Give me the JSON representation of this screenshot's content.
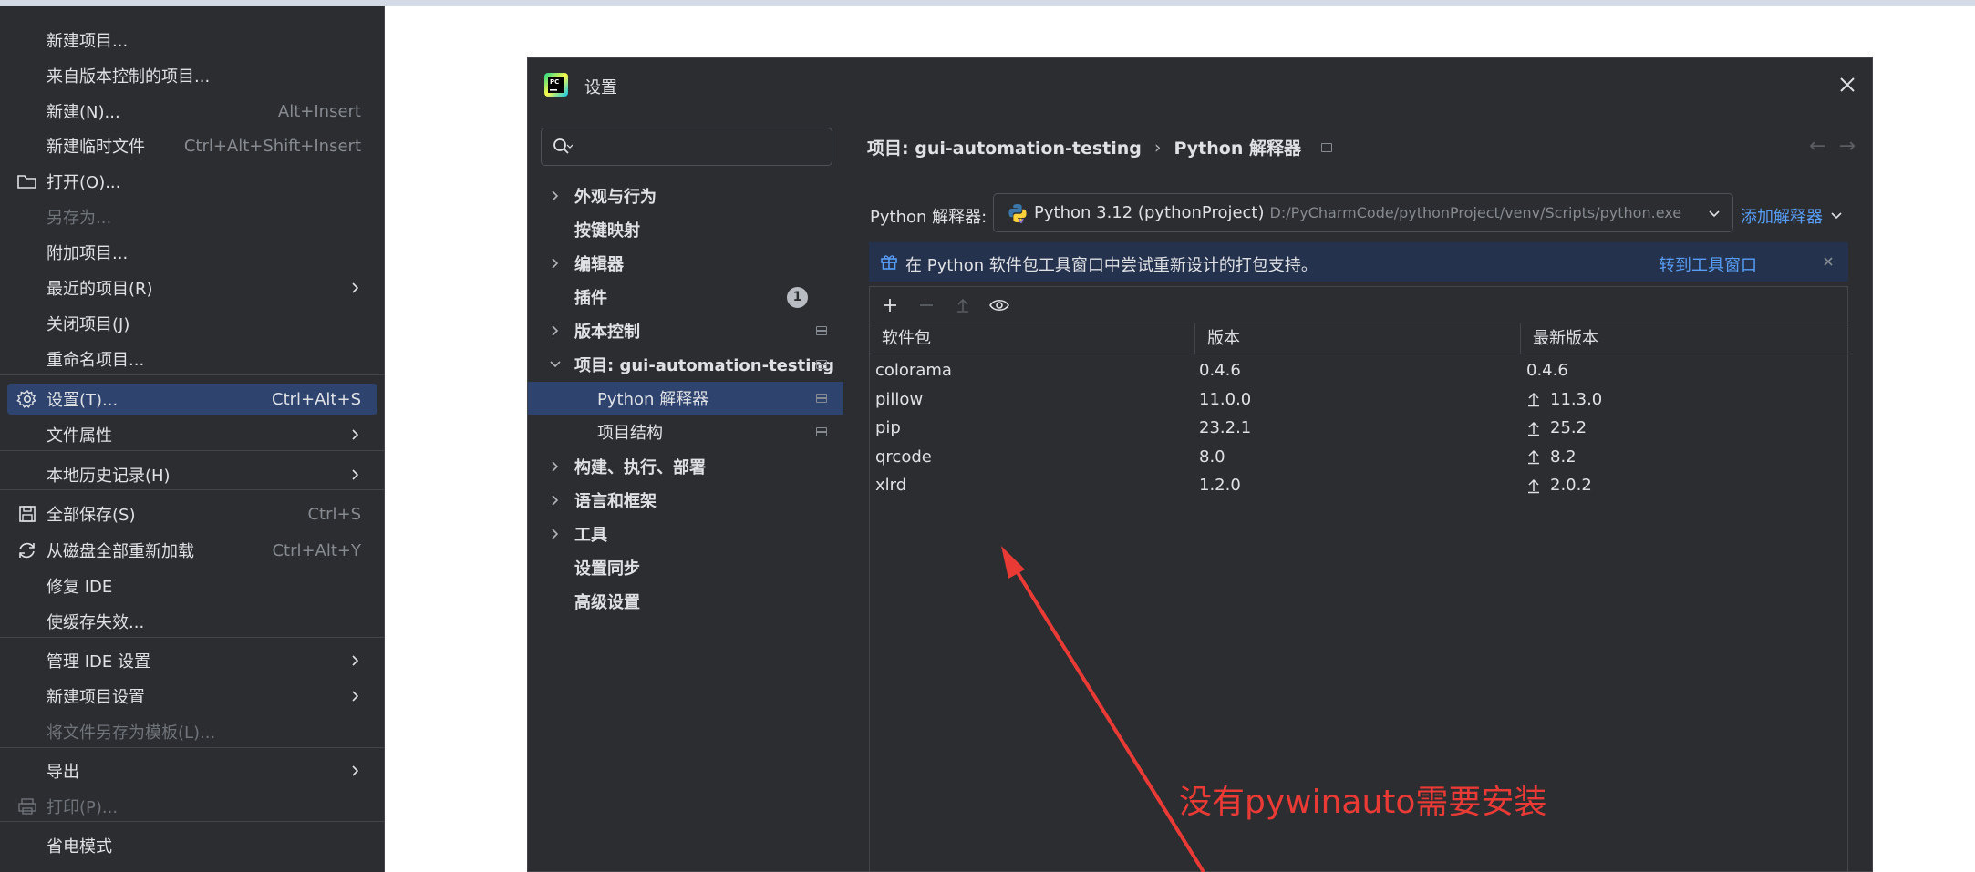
{
  "menu": {
    "items": [
      {
        "label": "新建项目...",
        "shortcut": "",
        "submenu": false,
        "icon": "",
        "disabled": false,
        "selected": false
      },
      {
        "label": "来自版本控制的项目...",
        "shortcut": "",
        "submenu": false,
        "icon": "",
        "disabled": false,
        "selected": false
      },
      {
        "label": "新建(N)...",
        "shortcut": "Alt+Insert",
        "submenu": false,
        "icon": "",
        "disabled": false,
        "selected": false
      },
      {
        "label": "新建临时文件",
        "shortcut": "Ctrl+Alt+Shift+Insert",
        "submenu": false,
        "icon": "",
        "disabled": false,
        "selected": false
      },
      {
        "label": "打开(O)...",
        "shortcut": "",
        "submenu": false,
        "icon": "folder-icon",
        "disabled": false,
        "selected": false
      },
      {
        "label": "另存为...",
        "shortcut": "",
        "submenu": false,
        "icon": "",
        "disabled": true,
        "selected": false
      },
      {
        "label": "附加项目...",
        "shortcut": "",
        "submenu": false,
        "icon": "",
        "disabled": false,
        "selected": false
      },
      {
        "label": "最近的项目(R)",
        "shortcut": "",
        "submenu": true,
        "icon": "",
        "disabled": false,
        "selected": false
      },
      {
        "label": "关闭项目(J)",
        "shortcut": "",
        "submenu": false,
        "icon": "",
        "disabled": false,
        "selected": false
      },
      {
        "label": "重命名项目...",
        "shortcut": "",
        "submenu": false,
        "icon": "",
        "disabled": false,
        "selected": false
      },
      {
        "label": "设置(T)...",
        "shortcut": "Ctrl+Alt+S",
        "submenu": false,
        "icon": "gear-icon",
        "disabled": false,
        "selected": true
      },
      {
        "label": "文件属性",
        "shortcut": "",
        "submenu": true,
        "icon": "",
        "disabled": false,
        "selected": false
      },
      {
        "label": "本地历史记录(H)",
        "shortcut": "",
        "submenu": true,
        "icon": "",
        "disabled": false,
        "selected": false
      },
      {
        "label": "全部保存(S)",
        "shortcut": "Ctrl+S",
        "submenu": false,
        "icon": "save-icon",
        "disabled": false,
        "selected": false
      },
      {
        "label": "从磁盘全部重新加载",
        "shortcut": "Ctrl+Alt+Y",
        "submenu": false,
        "icon": "reload-icon",
        "disabled": false,
        "selected": false
      },
      {
        "label": "修复 IDE",
        "shortcut": "",
        "submenu": false,
        "icon": "",
        "disabled": false,
        "selected": false
      },
      {
        "label": "使缓存失效...",
        "shortcut": "",
        "submenu": false,
        "icon": "",
        "disabled": false,
        "selected": false
      },
      {
        "label": "管理 IDE 设置",
        "shortcut": "",
        "submenu": true,
        "icon": "",
        "disabled": false,
        "selected": false
      },
      {
        "label": "新建项目设置",
        "shortcut": "",
        "submenu": true,
        "icon": "",
        "disabled": false,
        "selected": false
      },
      {
        "label": "将文件另存为模板(L)...",
        "shortcut": "",
        "submenu": false,
        "icon": "",
        "disabled": true,
        "selected": false
      },
      {
        "label": "导出",
        "shortcut": "",
        "submenu": true,
        "icon": "",
        "disabled": false,
        "selected": false
      },
      {
        "label": "打印(P)...",
        "shortcut": "",
        "submenu": false,
        "icon": "print-icon",
        "disabled": true,
        "selected": false
      },
      {
        "label": "省电模式",
        "shortcut": "",
        "submenu": false,
        "icon": "",
        "disabled": false,
        "selected": false
      }
    ]
  },
  "dialog": {
    "title": "设置",
    "search": {
      "placeholder": "",
      "value": ""
    },
    "tree": [
      {
        "label": "外观与行为",
        "expandable": true,
        "expanded": false,
        "indent": 0,
        "pinned": false,
        "badge": ""
      },
      {
        "label": "按键映射",
        "expandable": false,
        "expanded": false,
        "indent": 0,
        "pinned": false,
        "badge": ""
      },
      {
        "label": "编辑器",
        "expandable": true,
        "expanded": false,
        "indent": 0,
        "pinned": false,
        "badge": ""
      },
      {
        "label": "插件",
        "expandable": false,
        "expanded": false,
        "indent": 0,
        "pinned": false,
        "badge": "1"
      },
      {
        "label": "版本控制",
        "expandable": true,
        "expanded": false,
        "indent": 0,
        "pinned": true,
        "badge": ""
      },
      {
        "label": "项目: gui-automation-testing",
        "expandable": true,
        "expanded": true,
        "indent": 0,
        "pinned": true,
        "badge": ""
      },
      {
        "label": "Python 解释器",
        "expandable": false,
        "expanded": false,
        "indent": 1,
        "pinned": true,
        "badge": "",
        "selected": true
      },
      {
        "label": "项目结构",
        "expandable": false,
        "expanded": false,
        "indent": 1,
        "pinned": true,
        "badge": ""
      },
      {
        "label": "构建、执行、部署",
        "expandable": true,
        "expanded": false,
        "indent": 0,
        "pinned": false,
        "badge": ""
      },
      {
        "label": "语言和框架",
        "expandable": true,
        "expanded": false,
        "indent": 0,
        "pinned": false,
        "badge": ""
      },
      {
        "label": "工具",
        "expandable": true,
        "expanded": false,
        "indent": 0,
        "pinned": false,
        "badge": ""
      },
      {
        "label": "设置同步",
        "expandable": false,
        "expanded": false,
        "indent": 0,
        "pinned": false,
        "badge": ""
      },
      {
        "label": "高级设置",
        "expandable": false,
        "expanded": false,
        "indent": 0,
        "pinned": false,
        "badge": ""
      }
    ],
    "breadcrumb": {
      "parent": "项目: gui-automation-testing",
      "separator": "›",
      "current": "Python 解释器"
    },
    "nav": {
      "back": "←",
      "forward": "→"
    },
    "interpreter": {
      "label": "Python 解释器:",
      "name": "Python 3.12 (pythonProject)",
      "path": "D:/PyCharmCode/pythonProject/venv/Scripts/python.exe",
      "add_label": "添加解释器"
    },
    "banner": {
      "text": "在 Python 软件包工具窗口中尝试重新设计的打包支持。",
      "link": "转到工具窗口"
    },
    "packages": {
      "columns": [
        "软件包",
        "版本",
        "最新版本"
      ],
      "rows": [
        {
          "name": "colorama",
          "version": "0.4.6",
          "latest": "0.4.6",
          "upgrade": false
        },
        {
          "name": "pillow",
          "version": "11.0.0",
          "latest": "11.3.0",
          "upgrade": true
        },
        {
          "name": "pip",
          "version": "23.2.1",
          "latest": "25.2",
          "upgrade": true
        },
        {
          "name": "qrcode",
          "version": "8.0",
          "latest": "8.2",
          "upgrade": true
        },
        {
          "name": "xlrd",
          "version": "1.2.0",
          "latest": "2.0.2",
          "upgrade": true
        }
      ]
    }
  },
  "annotation": {
    "text": "没有pywinauto需要安装",
    "color": "#ea3a35"
  },
  "colors": {
    "accent": "#589df6",
    "selection": "#2e436e",
    "panel": "#2b2d30"
  }
}
